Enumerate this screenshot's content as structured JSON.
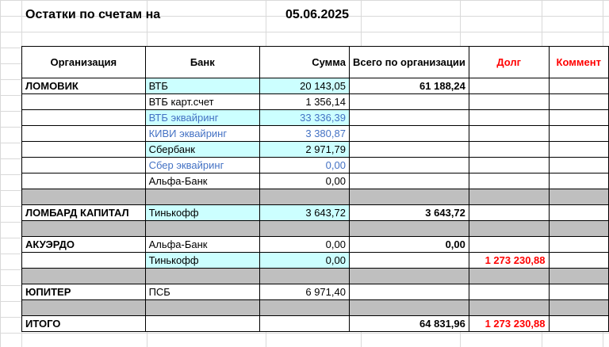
{
  "sheet": {
    "title": "Остатки по счетам на",
    "date": "05.06.2025",
    "headers": {
      "org": "Организация",
      "bank": "Банк",
      "sum": "Сумма",
      "total": "Всего по организации",
      "debt": "Долг",
      "comment": "Коммент"
    },
    "rows": [
      {
        "org": "ЛОМОВИК",
        "bank": "ВТБ",
        "sum": "20 143,05",
        "total": "61 188,24",
        "debt": "",
        "comment": ""
      },
      {
        "org": "",
        "bank": "ВТБ карт.счет",
        "sum": "1 356,14",
        "total": "",
        "debt": "",
        "comment": ""
      },
      {
        "org": "",
        "bank": "ВТБ эквайринг",
        "sum": "33 336,39",
        "total": "",
        "debt": "",
        "comment": ""
      },
      {
        "org": "",
        "bank": "КИВИ эквайринг",
        "sum": "3 380,87",
        "total": "",
        "debt": "",
        "comment": ""
      },
      {
        "org": "",
        "bank": "Сбербанк",
        "sum": "2 971,79",
        "total": "",
        "debt": "",
        "comment": ""
      },
      {
        "org": "",
        "bank": "Сбер эквайринг",
        "sum": "0,00",
        "total": "",
        "debt": "",
        "comment": ""
      },
      {
        "org": "",
        "bank": "Альфа-Банк",
        "sum": "0,00",
        "total": "",
        "debt": "",
        "comment": ""
      },
      {
        "org": "",
        "bank": "",
        "sum": "",
        "total": "",
        "debt": "",
        "comment": ""
      },
      {
        "org": "ЛОМБАРД КАПИТАЛ",
        "bank": "Тинькофф",
        "sum": "3 643,72",
        "total": "3 643,72",
        "debt": "",
        "comment": ""
      },
      {
        "org": "",
        "bank": "",
        "sum": "",
        "total": "",
        "debt": "",
        "comment": ""
      },
      {
        "org": "АКУЭРДО",
        "bank": "Альфа-Банк",
        "sum": "0,00",
        "total": "0,00",
        "debt": "",
        "comment": ""
      },
      {
        "org": "",
        "bank": "Тинькофф",
        "sum": "0,00",
        "total": "",
        "debt": "1 273 230,88",
        "comment": ""
      },
      {
        "org": "",
        "bank": "",
        "sum": "",
        "total": "",
        "debt": "",
        "comment": ""
      },
      {
        "org": "ЮПИТЕР",
        "bank": "ПСБ",
        "sum": "6 971,40",
        "total": "",
        "debt": "",
        "comment": ""
      },
      {
        "org": "",
        "bank": "",
        "sum": "",
        "total": "",
        "debt": "",
        "comment": ""
      },
      {
        "org": "ИТОГО",
        "bank": "",
        "sum": "",
        "total": "64 831,96",
        "debt": "1 273 230,88",
        "comment": ""
      }
    ]
  },
  "colors": {
    "cyan_fill": "#ccffff",
    "gray_fill": "#bfbfbf",
    "blue_text": "#4472c4",
    "red_text": "#ff0000"
  }
}
